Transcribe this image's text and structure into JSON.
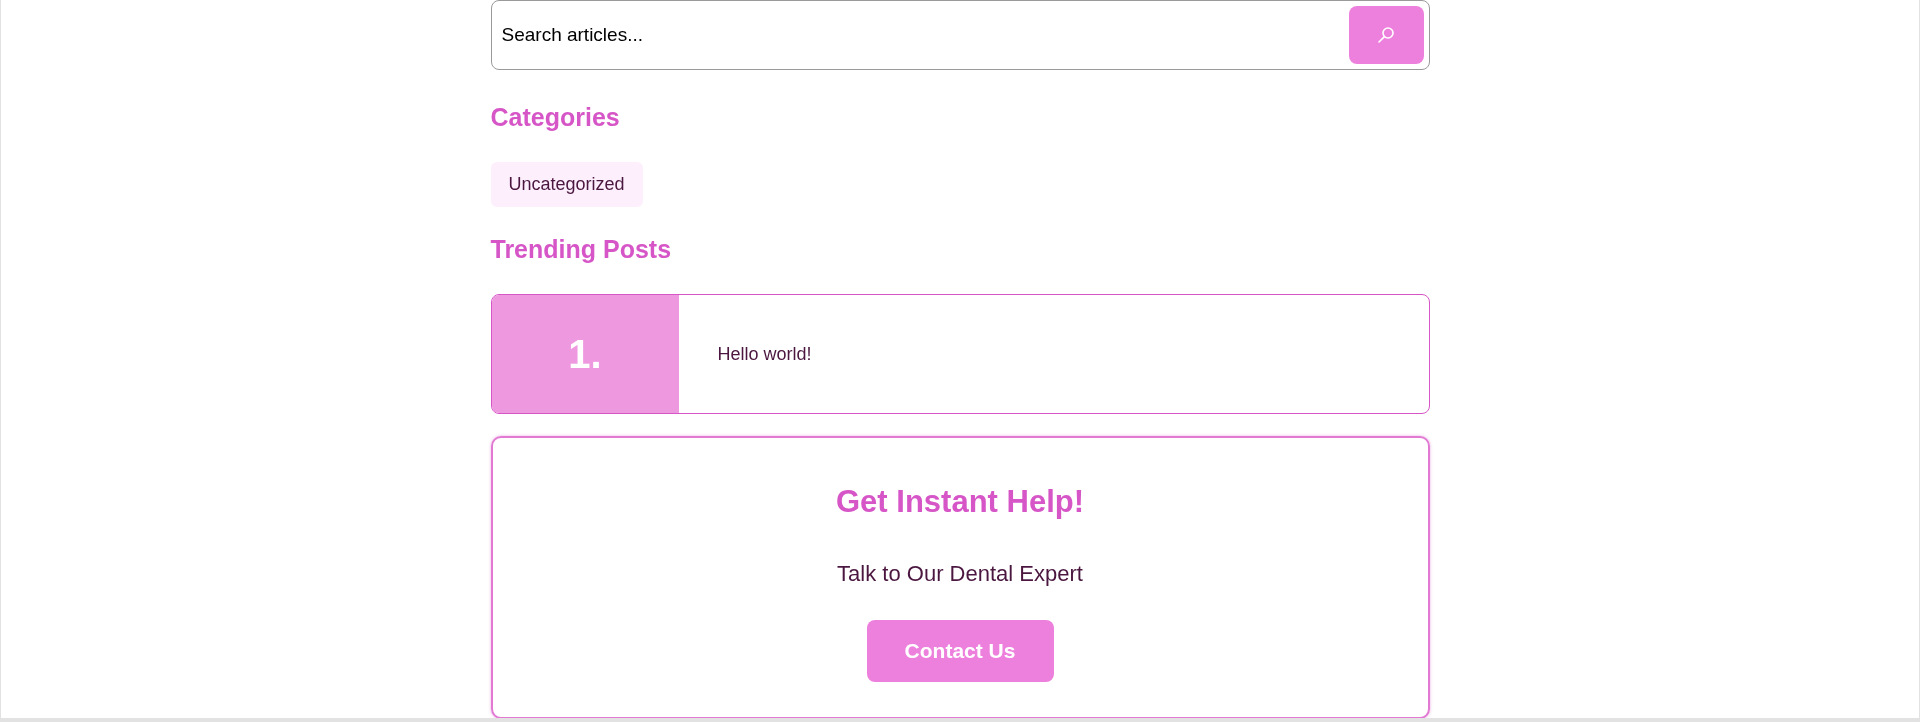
{
  "search": {
    "placeholder": "Search articles..."
  },
  "categories": {
    "title": "Categories",
    "items": [
      {
        "label": "Uncategorized"
      }
    ]
  },
  "trending": {
    "title": "Trending Posts",
    "posts": [
      {
        "rank": "1.",
        "title": "Hello world!"
      }
    ]
  },
  "help_card": {
    "title": "Get Instant Help!",
    "subtitle": "Talk to Our Dental Expert",
    "button": "Contact Us"
  }
}
